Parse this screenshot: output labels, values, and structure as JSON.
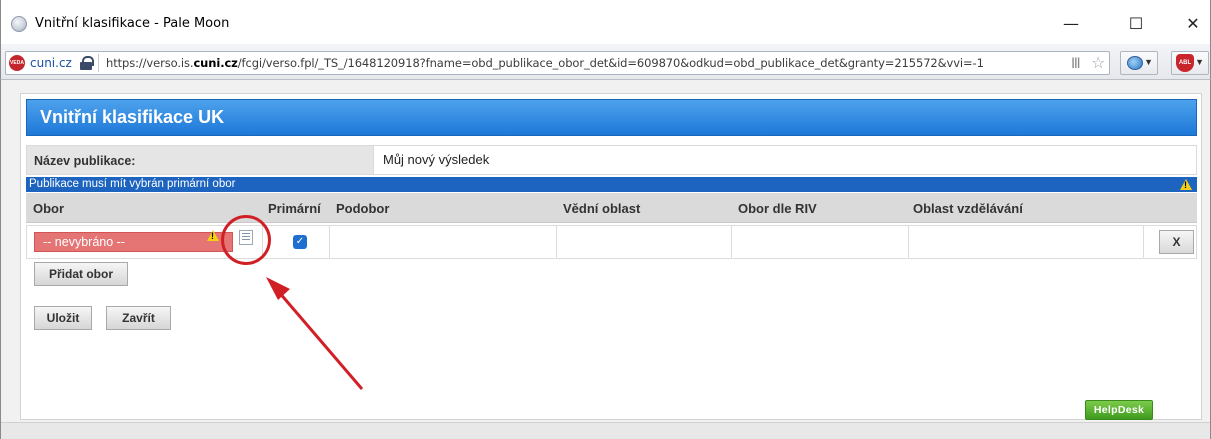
{
  "window": {
    "title": "Vnitřní klasifikace - Pale Moon",
    "minimize": "—",
    "maximize": "☐",
    "close": "✕"
  },
  "browser": {
    "site_badge": "VEDA",
    "site_domain": "cuni.cz",
    "url_prefix": "https://verso.is.",
    "url_highlight": "cuni.cz",
    "url_rest": "/fcgi/verso.fpl/_TS_/1648120918?fname=obd_publikace_obor_det&id=609870&odkud=obd_publikace_det&granty=215572&vvi=-1",
    "addon_shield_label": "ABL",
    "icons": [
      "lock-icon",
      "reader-icon",
      "star-icon",
      "globe-icon",
      "shield-icon"
    ]
  },
  "panel": {
    "title": "Vnitřní klasifikace UK",
    "name_label": "Název publikace:",
    "name_value": "Můj nový výsledek",
    "alert": "Publikace musí mít vybrán primární obor",
    "columns": [
      "Obor",
      "Primární",
      "Podobor",
      "Vědní oblast",
      "Obor dle RIV",
      "Oblast vzdělávání"
    ],
    "row": {
      "obor": "-- nevybráno --",
      "primary_checked": true,
      "check_glyph": "✓",
      "remove_label": "X"
    },
    "add_button": "Přidat obor",
    "save_button": "Uložit",
    "close_button": "Zavřít"
  },
  "helpdesk": "HelpDesk",
  "colors": {
    "header_blue": "#1d78d8",
    "alert_blue": "#1c64bf",
    "error_red": "#e57575",
    "annotation_red": "#d11f26",
    "helpdesk_green": "#3e9b1f"
  }
}
